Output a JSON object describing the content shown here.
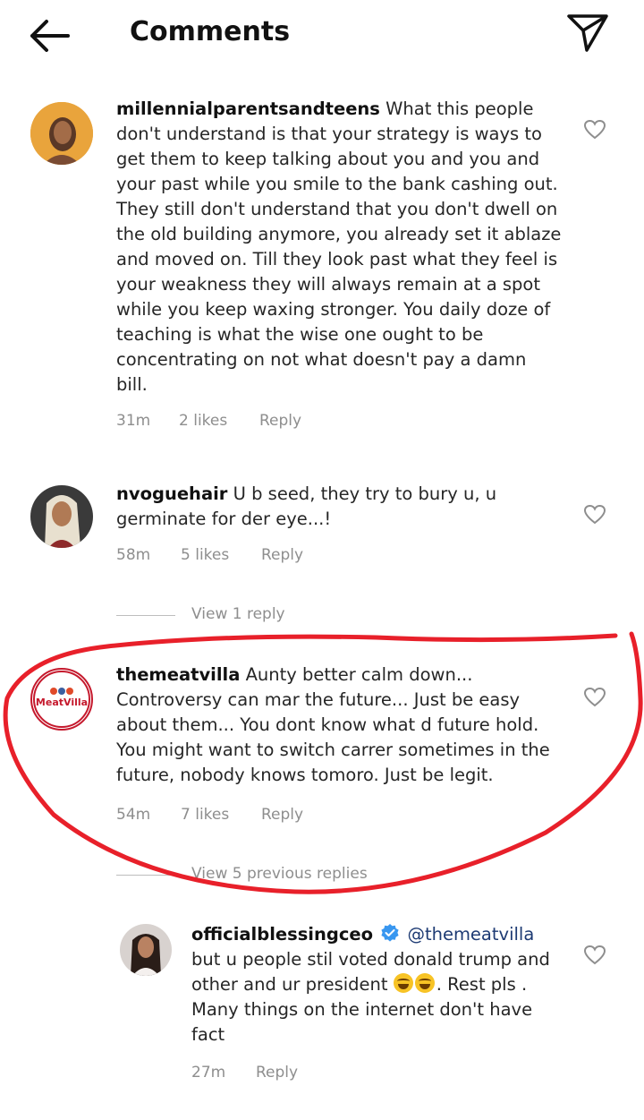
{
  "header": {
    "title": "Comments",
    "back_icon": "arrow-left-icon",
    "send_icon": "paper-plane-icon"
  },
  "comments": [
    {
      "username": "millennialparentsandteens",
      "text": "What this people don't understand is that your strategy is ways to get them to keep talking about you and you and your past while you smile to the bank cashing out. They still don't understand that you don't dwell on the old building anymore, you already set it ablaze and moved on. Till they look past what they feel is your weakness they will always remain at a spot while you keep waxing stronger. You daily doze of teaching is what the wise one ought to be concentrating on not what doesn't pay a damn bill.",
      "time": "31m",
      "likes": "2 likes",
      "reply": "Reply"
    },
    {
      "username": "nvoguehair",
      "text": "U b seed, they try to bury u, u germinate for der eye...!",
      "time": "58m",
      "likes": "5 likes",
      "reply": "Reply",
      "view_replies": "View 1 reply"
    },
    {
      "username": "themeatvilla",
      "avatar_label": "MeatVilla",
      "text": "Aunty better calm down... Controversy can mar the future... Just be easy about them... You dont know what d future hold. You might want to switch carrer sometimes in the future,  nobody knows tomoro. Just be legit.",
      "time": "54m",
      "likes": "7 likes",
      "reply": "Reply",
      "view_replies": "View 5 previous replies"
    }
  ],
  "reply": {
    "username": "officialblessingceo",
    "mention": "@themeatvilla",
    "text_before": "but u people stil voted donald trump and other and ur president",
    "text_after": ". Rest pls . Many things on the internet don't have fact",
    "time": "27m",
    "reply": "Reply"
  },
  "colors": {
    "annotation": "#e8202a",
    "verified": "#3897f0",
    "muted": "#8e8e8e"
  }
}
